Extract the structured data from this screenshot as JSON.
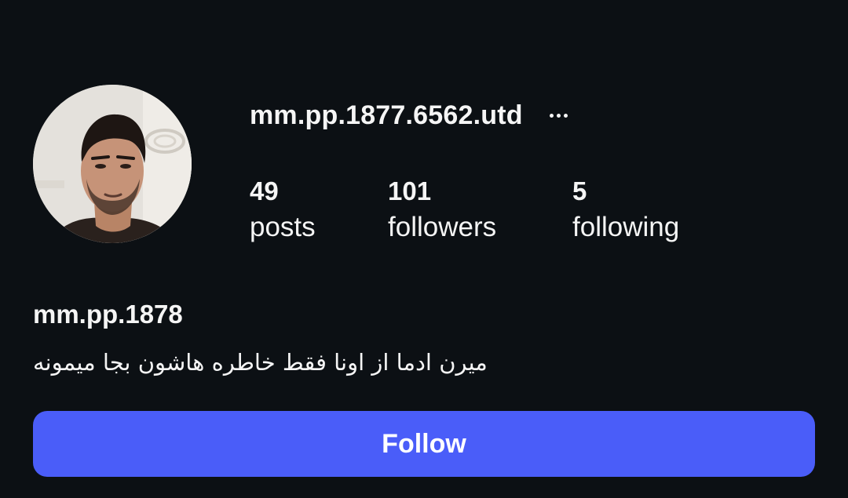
{
  "profile": {
    "username": "mm.pp.1877.6562.utd",
    "display_name": "mm.pp.1878",
    "bio": "میرن ادما از اونا فقط خاطره هاشون بجا میمونه",
    "avatar_icon": "profile-photo"
  },
  "stats": {
    "posts": {
      "count": "49",
      "label": "posts"
    },
    "followers": {
      "count": "101",
      "label": "followers"
    },
    "following": {
      "count": "5",
      "label": "following"
    }
  },
  "actions": {
    "follow_label": "Follow",
    "more_icon": "more-options-icon"
  },
  "colors": {
    "background": "#0c1014",
    "text": "#f5f5f5",
    "follow_button": "#4a5df9"
  }
}
